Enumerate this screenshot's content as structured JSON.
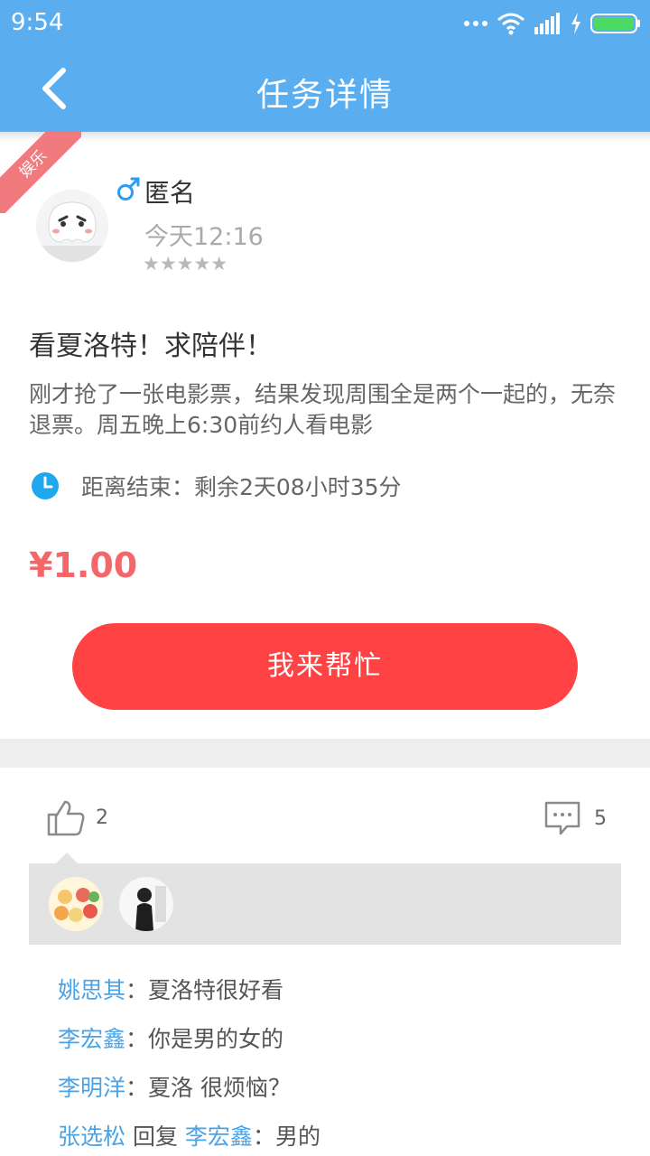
{
  "status": {
    "time": "9:54"
  },
  "header": {
    "title": "任务详情"
  },
  "task": {
    "category": "娱乐",
    "user": "匿名",
    "time": "今天12:16",
    "rating": 5,
    "title": "看夏洛特！求陪伴！",
    "description": "刚才抢了一张电影票，结果发现周围全是两个一起的，无奈退票。周五晚上6:30前约人看电影",
    "countdown": "距离结束：剩余2天08小时35分",
    "price": "¥1.00",
    "action_label": "我来帮忙"
  },
  "social": {
    "likes": "2",
    "comments": "5"
  },
  "comments": [
    {
      "name": "姚思其",
      "text": "：夏洛特很好看"
    },
    {
      "name": "李宏鑫",
      "text": "：你是男的女的"
    },
    {
      "name": "李明洋",
      "text": "：夏洛  很烦恼？"
    },
    {
      "name": "张选松",
      "reply_word": " 回复 ",
      "reply_to": "李宏鑫",
      "text": "：男的"
    }
  ],
  "colors": {
    "primary": "#5aaef0",
    "accent": "#ff4244",
    "price": "#f46668",
    "name": "#4aa3e6"
  }
}
